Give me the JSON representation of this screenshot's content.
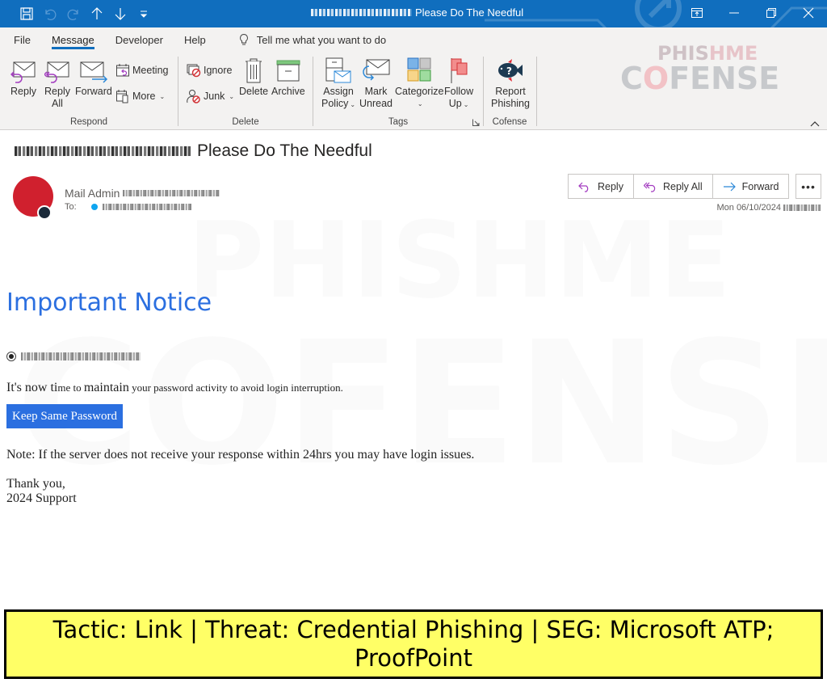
{
  "window": {
    "title_suffix": "Please Do The Needful",
    "title_redacted": true,
    "quick_access": [
      {
        "name": "save-icon",
        "label": "Save"
      },
      {
        "name": "undo-icon",
        "label": "Undo"
      },
      {
        "name": "redo-icon",
        "label": "Redo"
      },
      {
        "name": "previous-item-icon",
        "label": "Previous Item"
      },
      {
        "name": "next-item-icon",
        "label": "Next Item"
      },
      {
        "name": "customize-qat-icon",
        "label": "Customize Quick Access Toolbar"
      }
    ],
    "controls": [
      "ribbon-display-options",
      "minimize",
      "restore",
      "close"
    ]
  },
  "menu": {
    "tabs": [
      "File",
      "Message",
      "Developer",
      "Help"
    ],
    "active_tab": "Message",
    "tell_me_placeholder": "Tell me what you want to do"
  },
  "ribbon": {
    "groups": [
      {
        "label": "Respond",
        "buttons": [
          "Reply",
          "Reply All",
          "Forward",
          "Meeting",
          "More"
        ]
      },
      {
        "label": "Delete",
        "buttons": [
          "Ignore",
          "Junk",
          "Delete",
          "Archive"
        ]
      },
      {
        "label": "Tags",
        "buttons": [
          "Assign Policy",
          "Mark Unread",
          "Categorize",
          "Follow Up"
        ]
      },
      {
        "label": "Cofense",
        "buttons": [
          "Report Phishing"
        ]
      }
    ],
    "respond": {
      "reply": "Reply",
      "reply_all_1": "Reply",
      "reply_all_2": "All",
      "forward": "Forward",
      "meeting": "Meeting",
      "more": "More"
    },
    "delete": {
      "ignore": "Ignore",
      "junk": "Junk",
      "delete": "Delete",
      "archive": "Archive"
    },
    "tags": {
      "assign_1": "Assign",
      "assign_2": "Policy",
      "mark_1": "Mark",
      "mark_2": "Unread",
      "categorize": "Categorize",
      "follow_1": "Follow",
      "follow_2": "Up"
    },
    "cofense": {
      "report_1": "Report",
      "report_2": "Phishing"
    },
    "group_labels": {
      "respond": "Respond",
      "delete": "Delete",
      "tags": "Tags",
      "cofense": "Cofense"
    },
    "brand_watermark": {
      "line1": "PHISHME",
      "line2": "COFENSE"
    }
  },
  "message": {
    "subject": "Please Do The Needful",
    "subject_prefix_redacted": true,
    "sender_name": "Mail Admin",
    "sender_email_redacted": true,
    "to_label": "To:",
    "recipient_redacted": true,
    "actions": {
      "reply": "Reply",
      "reply_all": "Reply All",
      "forward": "Forward",
      "more": "•••"
    },
    "date": "Mon 06/10/2024",
    "time_redacted": true,
    "avatar_color": "#d0202e"
  },
  "email_body": {
    "heading": "Important Notice",
    "heading_color": "#2b6fe0",
    "email_redacted": true,
    "line_part1": "It's now ti",
    "line_part2": "me to ",
    "line_part3": "maintain",
    "line_part4": " your password activity to avoid login interruption.",
    "button_label": "Keep Same Password",
    "button_color": "#2b6fe0",
    "note": "Note: If the server does not receive your response within 24hrs you may have login issues.",
    "signoff_1": "Thank you,",
    "signoff_2": "2024 Support"
  },
  "banner": {
    "text": "Tactic: Link | Threat: Credential Phishing | SEG: Microsoft ATP; ProofPoint",
    "background": "#ffff66"
  }
}
